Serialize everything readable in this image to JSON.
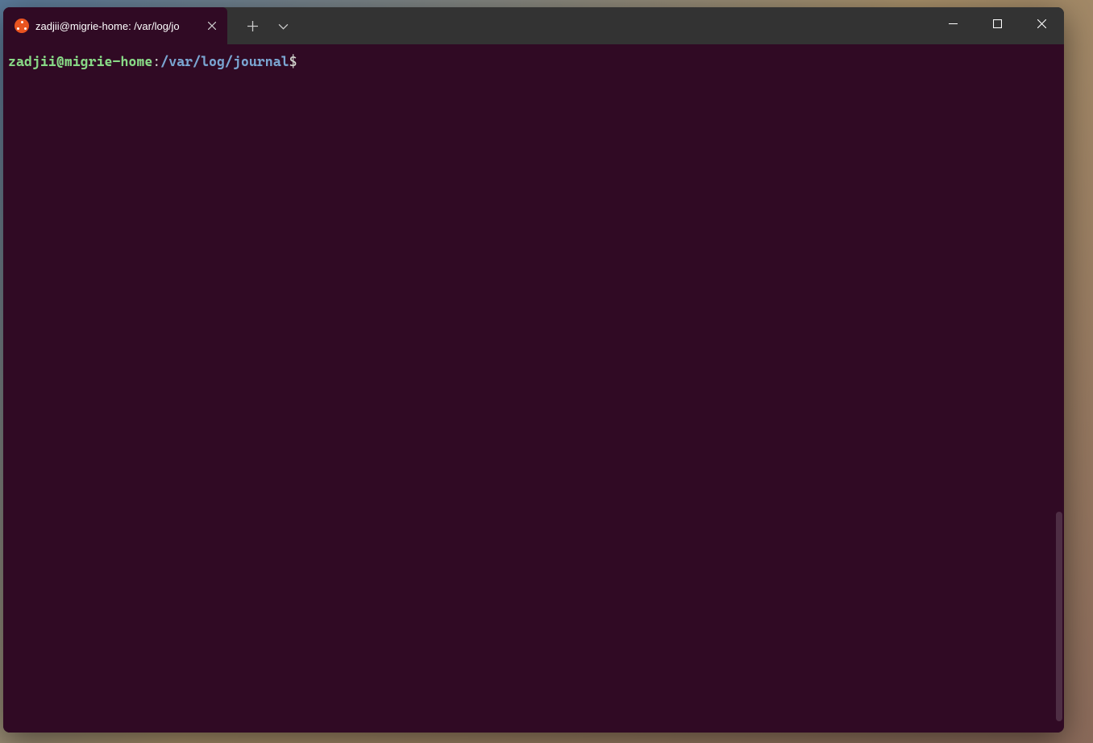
{
  "tab": {
    "title": "zadjii@migrie-home: /var/log/jo",
    "icon": "ubuntu-icon"
  },
  "prompt": {
    "userhost": "zadjii@migrie-home",
    "separator": ":",
    "path": "/var/log/journal",
    "symbol": "$"
  },
  "colors": {
    "terminal_bg": "#300a24",
    "titlebar_bg": "#333333",
    "userhost": "#88d986",
    "path": "#7aa5d1",
    "ubuntu_orange": "#E95420"
  }
}
